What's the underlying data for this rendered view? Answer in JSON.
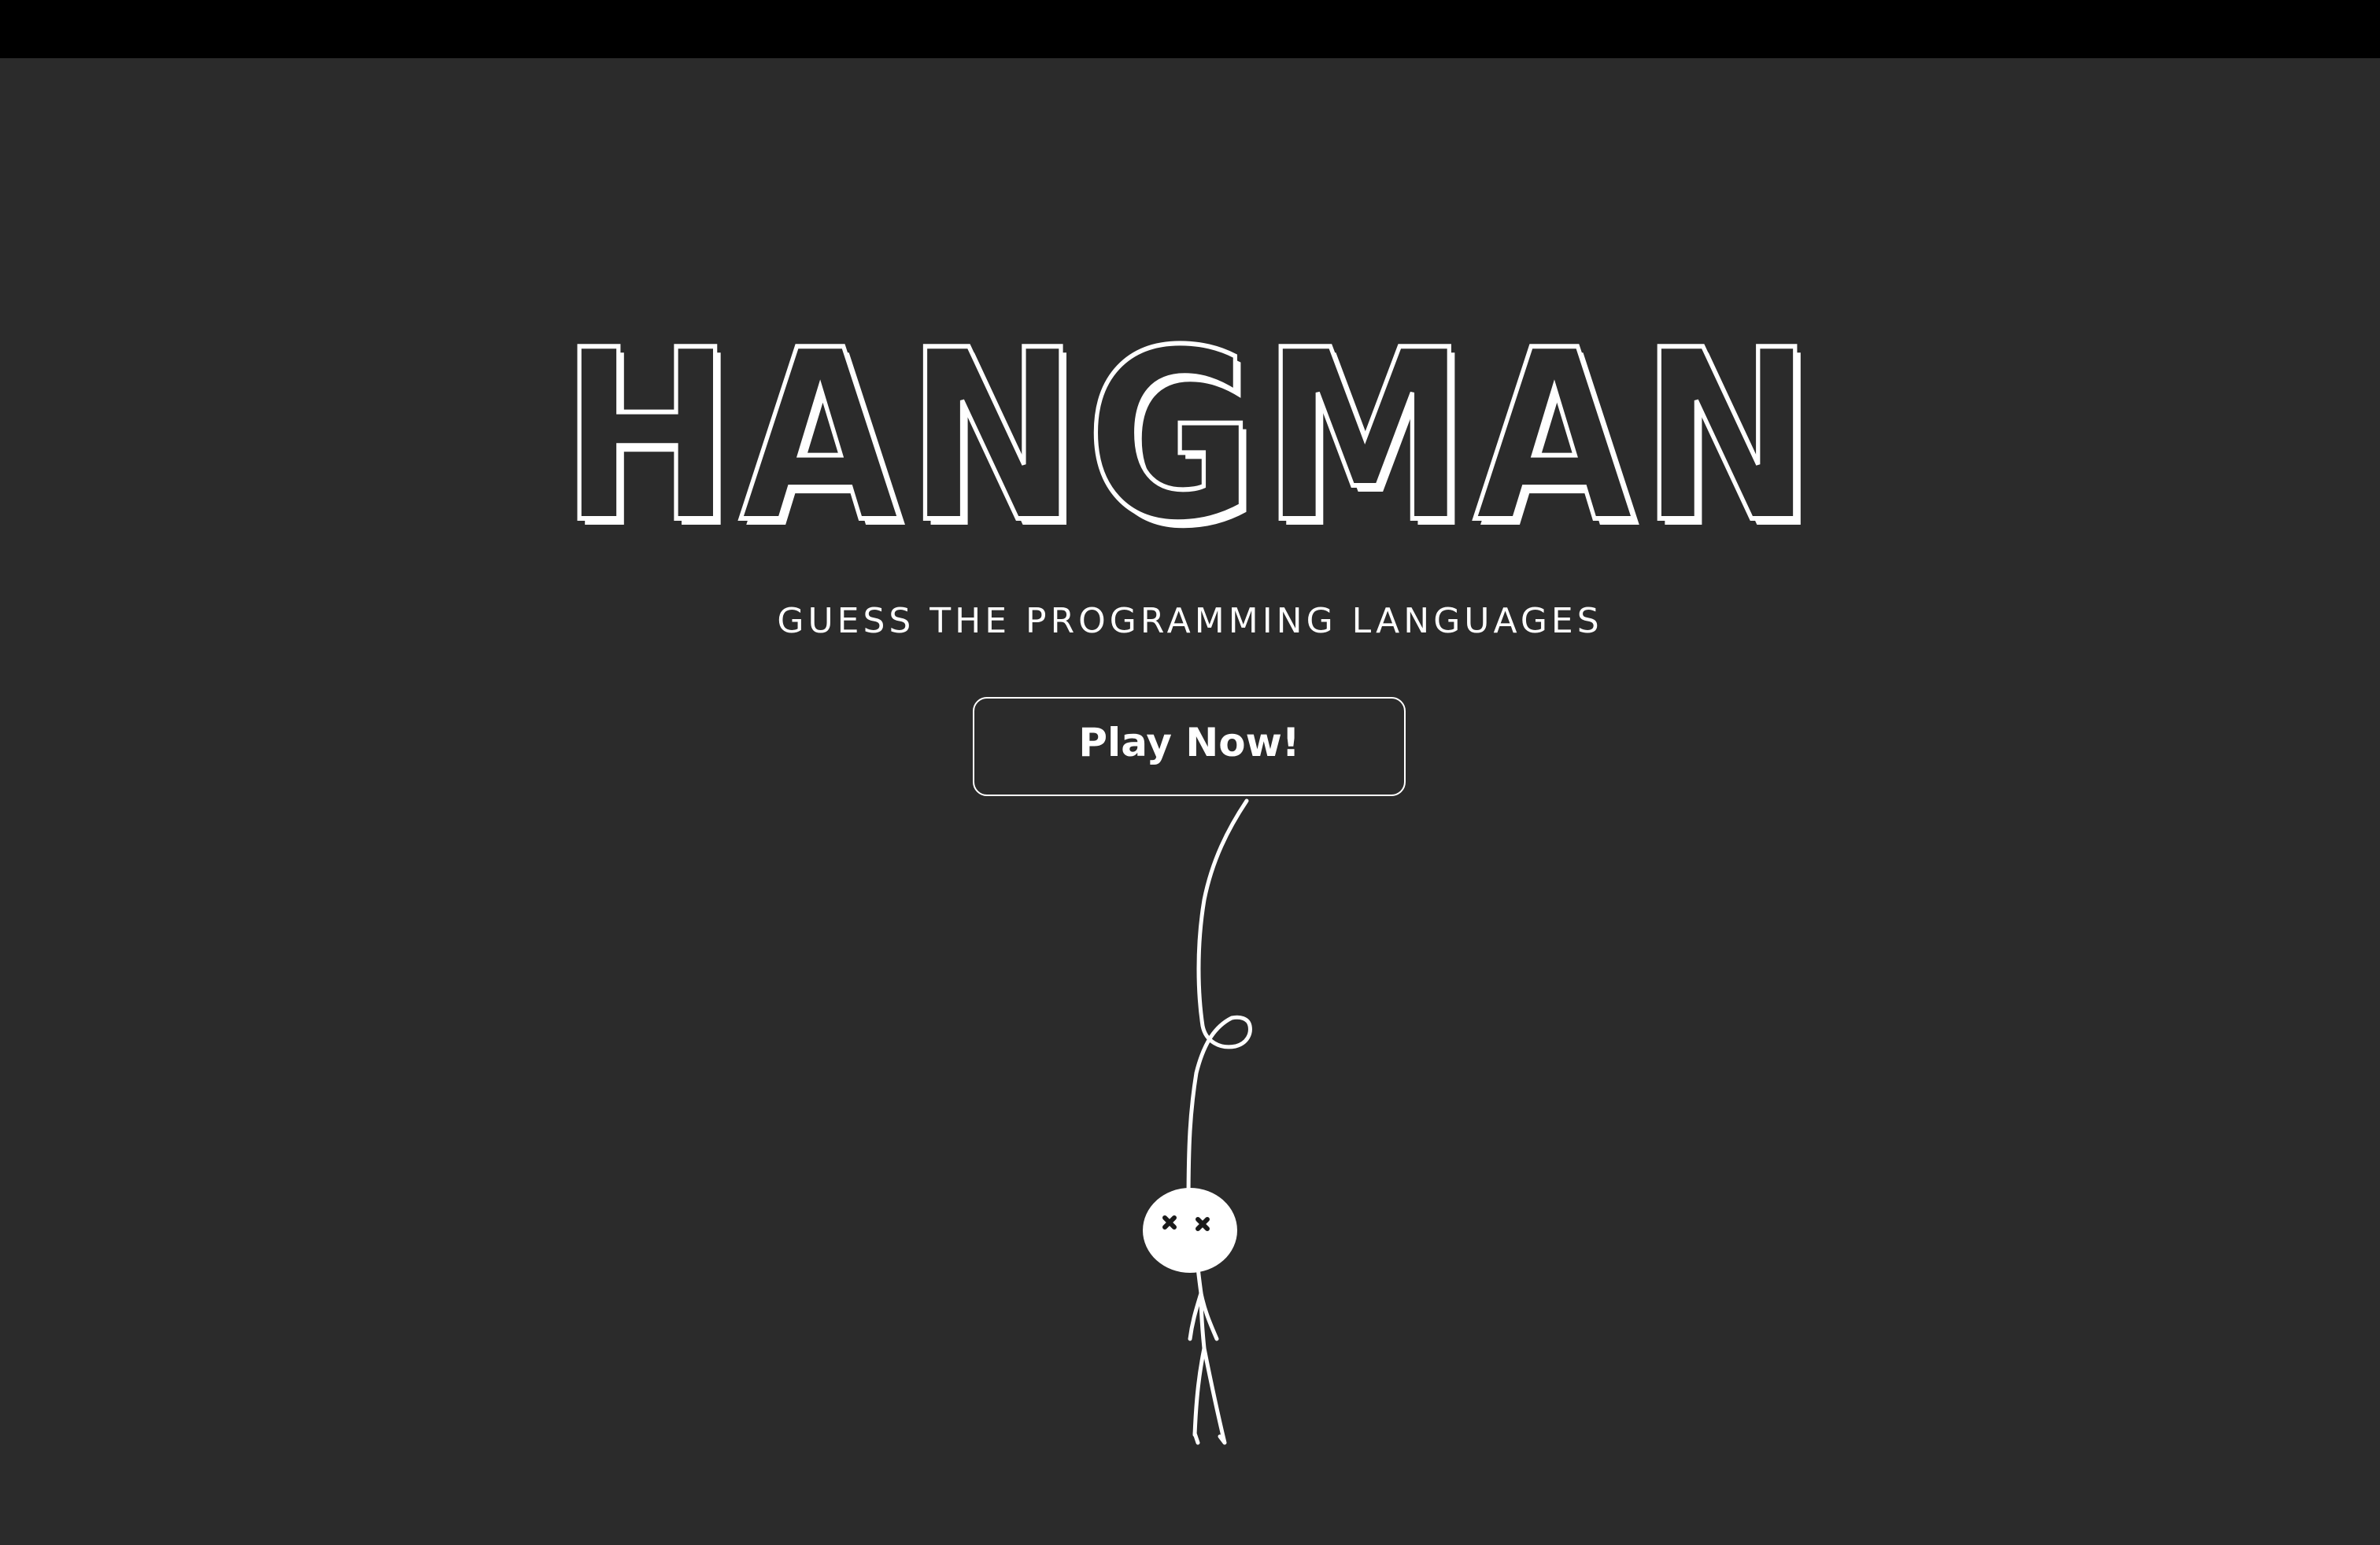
{
  "app": {
    "title": "HANGMAN",
    "subtitle": "GUESS THE PROGRAMMING LANGUAGES"
  },
  "actions": {
    "play_label": "Play Now!"
  },
  "colors": {
    "background": "#2b2b2b",
    "top_bar": "#000000",
    "foreground": "#ffffff"
  },
  "icons": {
    "figure": "hanging-stickman-icon"
  }
}
